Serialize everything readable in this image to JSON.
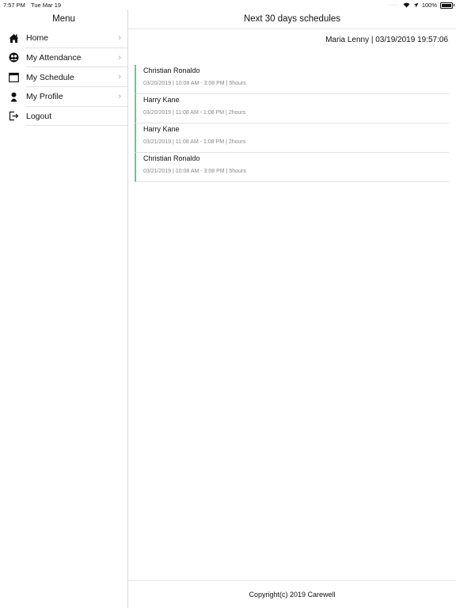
{
  "status_bar": {
    "time": "7:57 PM",
    "date": "Tue Mar 19",
    "battery": "100%"
  },
  "sidebar": {
    "title": "Menu",
    "items": [
      {
        "label": "Home",
        "icon": "home-icon",
        "chevron": true
      },
      {
        "label": "My Attendance",
        "icon": "attendance-icon",
        "chevron": true
      },
      {
        "label": "My Schedule",
        "icon": "calendar-icon",
        "chevron": true
      },
      {
        "label": "My Profile",
        "icon": "person-icon",
        "chevron": true
      },
      {
        "label": "Logout",
        "icon": "logout-icon",
        "chevron": false
      }
    ]
  },
  "main": {
    "title": "Next 30 days schedules",
    "user_stamp": "Maria Lenny | 03/19/2019 19:57:06",
    "schedules": [
      {
        "name": "Christian Ronaldo",
        "details": "03/20/2019 | 10:08 AM - 3:08 PM | 5hours"
      },
      {
        "name": "Harry Kane",
        "details": "03/20/2019 | 11:08 AM - 1:08 PM | 2hours"
      },
      {
        "name": "Harry Kane",
        "details": "03/21/2019 | 11:08 AM - 1:08 PM | 2hours"
      },
      {
        "name": "Christian Ronaldo",
        "details": "03/21/2019 | 10:08 AM - 3:08 PM | 5hours"
      }
    ],
    "footer": "Copyright(c) 2019 Carewell"
  },
  "colors": {
    "accent_bar": "#6cc58a",
    "divider": "#e2e2e2"
  }
}
